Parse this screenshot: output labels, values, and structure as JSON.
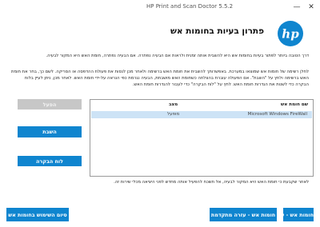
{
  "window": {
    "title": "HP Print and Scan Doctor 5.5.2",
    "minimize_glyph": "—",
    "close_glyph": "✕"
  },
  "header": {
    "page_title": "פתרון בעיות בחומות אש",
    "logo_text": "hp",
    "brand_color": "#0f85cf"
  },
  "intro": {
    "line1": "דרך הטובה ביותר לפתור בעיות בחומות אש היא להשבית אותה זמנית ולראות אם הבעיה נפתרה. אם הבעיה נפתרה, חומת האש היא המקור לבעיה.",
    "line2": "לחלן רשימה של חומות אש שמוצאו במערכת. באפשרותך להשבית את חומת האש ברשימה ולאחר מכן לנסות את פעולת ההדפסה או הסריקה. לשם כך, בחר את חומת האש ברשימה ולחץ על \"השבת\". אם הפעולה עוברת בהצלחה כשחומת האש מושבתת, הבעיה נגרמת כפי הנראה על-ידי חומת האש. לאחר מכן, ניתן לעיין בלוח הבקרה כדי לשנות את הגדרות חומת האש. לחץ על \"לוח הבקרה\" כדי לעבור להגדרות חומת האש."
  },
  "firewall_table": {
    "columns": {
      "name": "שם חומת אש",
      "status": "מצב"
    },
    "rows": [
      {
        "name": "Microsoft Windows FireWall",
        "status": "מופעל"
      }
    ]
  },
  "buttons": {
    "enable": "הפעל",
    "disable": "השבת",
    "control_panel": "לוח הבקרה",
    "help_firewall": "חומות אש - עזרה",
    "help_advanced": "חומות אש - עזרה מתקדמת",
    "finish": "סיום השימוש בחומות אש"
  },
  "footer_note": "לאחר שקבעת כי חומת האש היא המקור לבעיה, אל תשכח להפעיל אותה מחדש לפני היציאה מכלי שירות זה."
}
